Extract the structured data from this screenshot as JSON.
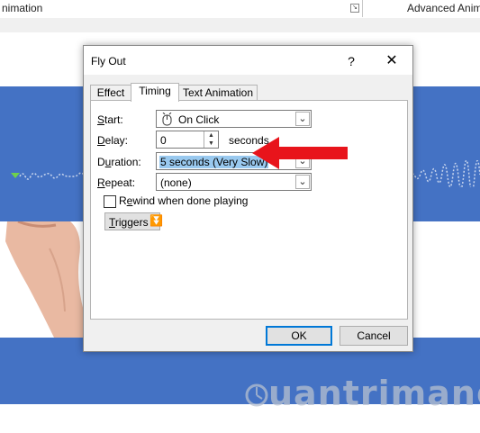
{
  "ribbon": {
    "left_label": "nimation",
    "right_label": "Advanced Anim"
  },
  "dialog": {
    "title": "Fly Out",
    "help": "?",
    "close": "✕",
    "tabs": [
      {
        "label": "Effect",
        "active": false
      },
      {
        "label": "Timing",
        "active": true
      },
      {
        "label": "Text Animation",
        "active": false
      }
    ],
    "start": {
      "label": "Start:",
      "value": "On Click"
    },
    "delay": {
      "label": "Delay:",
      "value": "0",
      "unit": "seconds"
    },
    "duration": {
      "label": "Duration:",
      "value": "5 seconds (Very Slow)"
    },
    "repeat": {
      "label": "Repeat:",
      "value": "(none)"
    },
    "rewind": {
      "label": "Rewind when done playing",
      "checked": false
    },
    "triggers": {
      "label": "Triggers"
    },
    "ok": "OK",
    "cancel": "Cancel"
  },
  "watermark": {
    "text": "uantrimang"
  },
  "colors": {
    "accent_blue": "#4472c4",
    "arrow_red": "#e8141b",
    "selection": "#99c9ef"
  }
}
